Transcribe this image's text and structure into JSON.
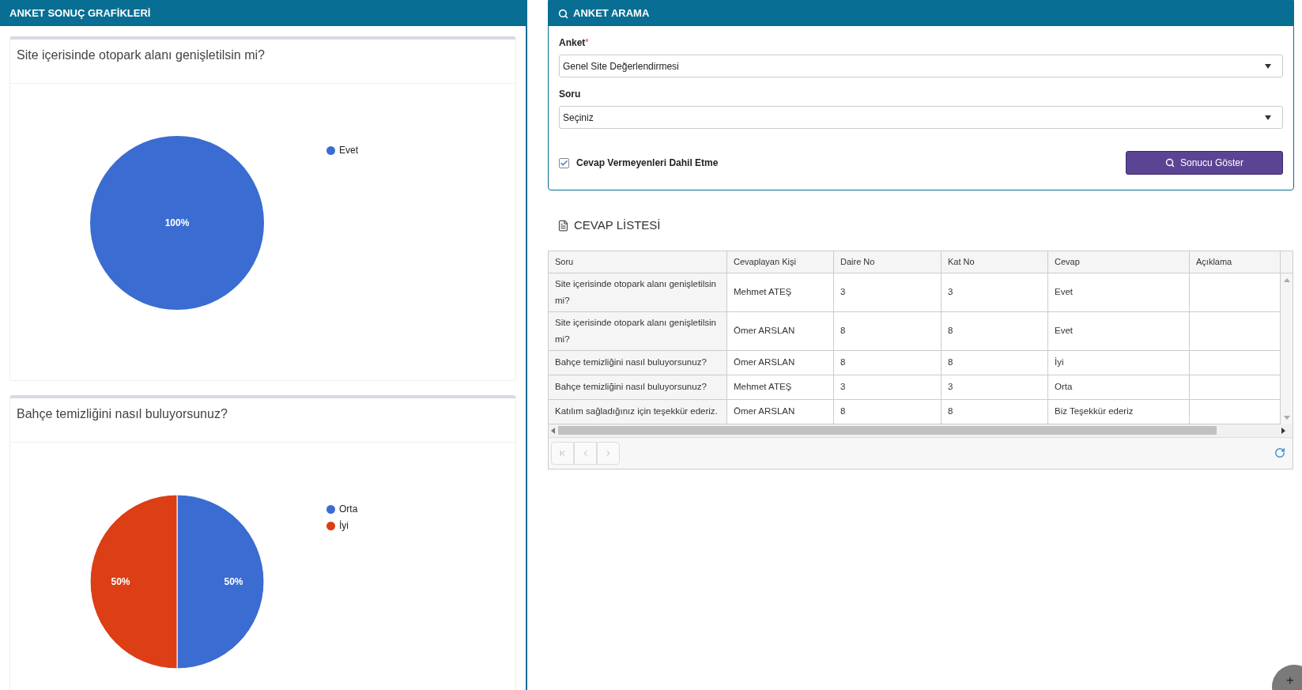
{
  "results_panel": {
    "title": "ANKET SONUÇ GRAFİKLERİ",
    "charts": [
      {
        "question": "Site içerisinde otopark alanı genişletilsin mi?",
        "chart_data": {
          "type": "pie",
          "categories": [
            "Evet"
          ],
          "values": [
            100
          ],
          "colors": [
            "#3a6cd1"
          ],
          "value_labels": [
            "100%"
          ],
          "legend": "right"
        }
      },
      {
        "question": "Bahçe temizliğini nasıl buluyorsunuz?",
        "chart_data": {
          "type": "pie",
          "categories": [
            "Orta",
            "İyi"
          ],
          "values": [
            50,
            50
          ],
          "colors": [
            "#3a6cd1",
            "#dc3e15"
          ],
          "value_labels": [
            "50%",
            "50%"
          ],
          "legend": "right"
        }
      }
    ]
  },
  "search_panel": {
    "title": "ANKET ARAMA",
    "fields": [
      {
        "label": "Anket",
        "required_mark": "*",
        "value": "Genel Site Değerlendirmesi"
      },
      {
        "label": "Soru",
        "value": "Seçiniz"
      }
    ],
    "checkbox": {
      "label": "Cevap Vermeyenleri Dahil Etme",
      "checked": true
    },
    "button": "Sonucu Göster"
  },
  "answer_list": {
    "title": "CEVAP LİSTESİ",
    "table": {
      "columns": [
        "Soru",
        "Cevaplayan Kişi",
        "Daire No",
        "Kat No",
        "Cevap",
        "Açıklama"
      ],
      "rows": [
        [
          "Site içerisinde otopark alanı genişletilsin mi?",
          "Mehmet ATEŞ",
          "3",
          "3",
          "Evet",
          ""
        ],
        [
          "Site içerisinde otopark alanı genişletilsin mi?",
          "Ömer ARSLAN",
          "8",
          "8",
          "Evet",
          ""
        ],
        [
          "Bahçe temizliğini nasıl buluyorsunuz?",
          "Ömer ARSLAN",
          "8",
          "8",
          "İyi",
          ""
        ],
        [
          "Bahçe temizliğini nasıl buluyorsunuz?",
          "Mehmet ATEŞ",
          "3",
          "3",
          "Orta",
          ""
        ],
        [
          "Katılım sağladığınız için teşekkür ederiz.",
          "Ömer ARSLAN",
          "8",
          "8",
          "Biz Teşekkür ederiz",
          ""
        ]
      ]
    }
  },
  "fab": "+"
}
